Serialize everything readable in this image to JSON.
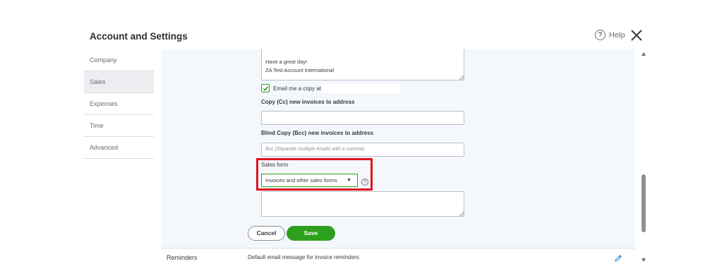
{
  "header": {
    "title": "Account and Settings",
    "help_label": "Help",
    "help_icon_glyph": "?"
  },
  "sidebar": {
    "items": [
      {
        "label": "Company",
        "active": false
      },
      {
        "label": "Sales",
        "active": true
      },
      {
        "label": "Expenses",
        "active": false
      },
      {
        "label": "Time",
        "active": false
      },
      {
        "label": "Advanced",
        "active": false
      }
    ]
  },
  "form": {
    "message_lines": [
      "Have a great day!",
      "ZA Test Account International"
    ],
    "email_copy_label": "Email me a copy at",
    "email_copy_checked": true,
    "cc_label": "Copy (Cc) new invoices to address",
    "cc_value": "",
    "bcc_label": "Blind Copy (Bcc) new invoices to address",
    "bcc_placeholder": "Bcc (Separate multiple emails with a comma)",
    "sales_form_label": "Sales form",
    "sales_form_selected": "Invoices and other sales forms",
    "info_icon_glyph": "?",
    "cancel_label": "Cancel",
    "save_label": "Save"
  },
  "reminders": {
    "label": "Reminders",
    "description": "Default email message for invoice reminders"
  },
  "colors": {
    "accent_green": "#2ca01c",
    "highlight_red": "#e0141e",
    "panel_bg": "#f4f8fd"
  }
}
